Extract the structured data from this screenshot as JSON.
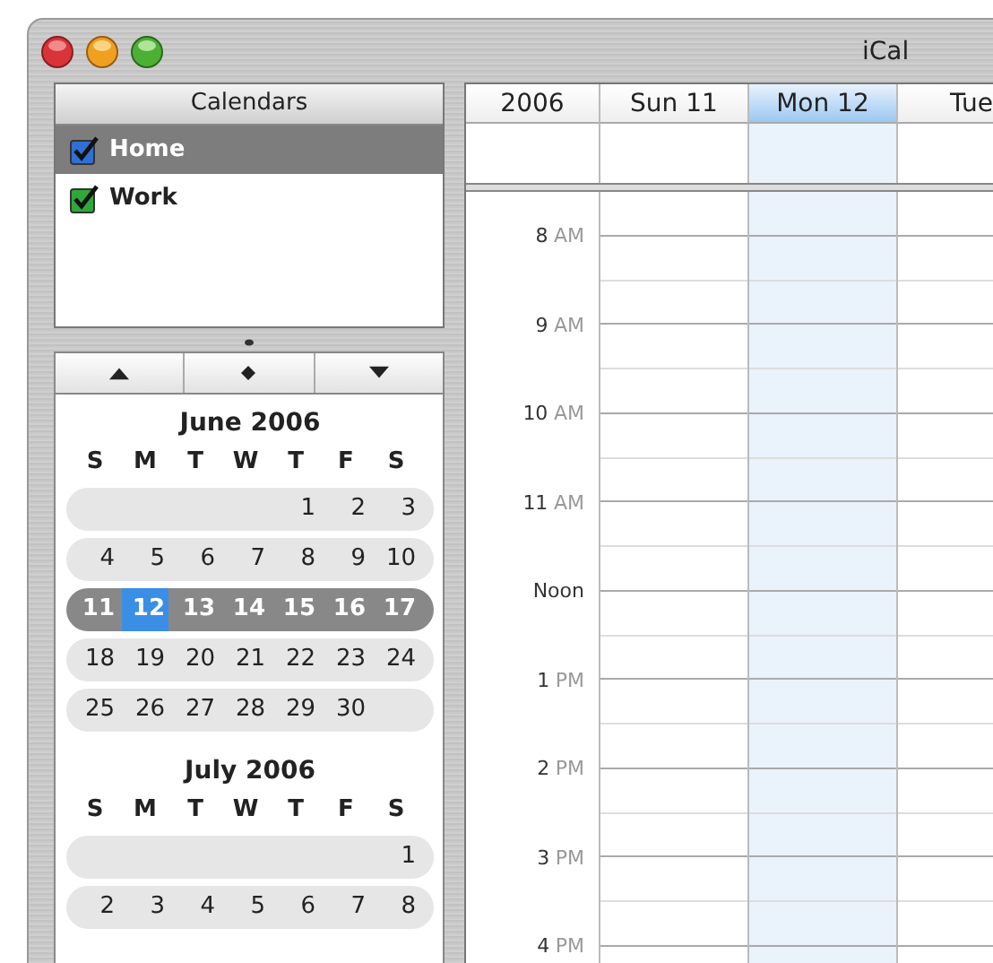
{
  "window": {
    "title": "iCal"
  },
  "calendars": {
    "header": "Calendars",
    "items": [
      {
        "name": "Home",
        "checked": true,
        "selected": true,
        "color": "#2f6fd6"
      },
      {
        "name": "Work",
        "checked": true,
        "selected": false,
        "color": "#2fa83a"
      }
    ]
  },
  "mini_calendars": [
    {
      "title": "June 2006",
      "weekdays": [
        "S",
        "M",
        "T",
        "W",
        "T",
        "F",
        "S"
      ],
      "weeks": [
        {
          "selected": false,
          "days": [
            {
              "label": "1",
              "selected": false
            },
            {
              "label": "2",
              "selected": false
            },
            {
              "label": "3",
              "selected": false
            }
          ]
        },
        {
          "selected": false,
          "days": [
            {
              "label": "4",
              "selected": false
            },
            {
              "label": "5",
              "selected": false
            },
            {
              "label": "6",
              "selected": false
            },
            {
              "label": "7",
              "selected": false
            },
            {
              "label": "8",
              "selected": false
            },
            {
              "label": "9",
              "selected": false
            },
            {
              "label": "10",
              "selected": false
            }
          ]
        },
        {
          "selected": true,
          "days": [
            {
              "label": "11",
              "selected": false
            },
            {
              "label": "12",
              "selected": true
            },
            {
              "label": "13",
              "selected": false
            },
            {
              "label": "14",
              "selected": false
            },
            {
              "label": "15",
              "selected": false
            },
            {
              "label": "16",
              "selected": false
            },
            {
              "label": "17",
              "selected": false
            }
          ]
        },
        {
          "selected": false,
          "days": [
            {
              "label": "18",
              "selected": false
            },
            {
              "label": "19",
              "selected": false
            },
            {
              "label": "20",
              "selected": false
            },
            {
              "label": "21",
              "selected": false
            },
            {
              "label": "22",
              "selected": false
            },
            {
              "label": "23",
              "selected": false
            },
            {
              "label": "24",
              "selected": false
            }
          ]
        },
        {
          "selected": false,
          "days": [
            {
              "label": "25",
              "selected": false
            },
            {
              "label": "26",
              "selected": false
            },
            {
              "label": "27",
              "selected": false
            },
            {
              "label": "28",
              "selected": false
            },
            {
              "label": "29",
              "selected": false
            },
            {
              "label": "30",
              "selected": false
            }
          ]
        }
      ]
    },
    {
      "title": "July 2006",
      "weekdays": [
        "S",
        "M",
        "T",
        "W",
        "T",
        "F",
        "S"
      ],
      "weeks": [
        {
          "selected": false,
          "days": [
            {
              "label": "1",
              "selected": false
            }
          ]
        },
        {
          "selected": false,
          "days": [
            {
              "label": "2",
              "selected": false
            },
            {
              "label": "3",
              "selected": false
            },
            {
              "label": "4",
              "selected": false
            },
            {
              "label": "5",
              "selected": false
            },
            {
              "label": "6",
              "selected": false
            },
            {
              "label": "7",
              "selected": false
            },
            {
              "label": "8",
              "selected": false
            }
          ]
        }
      ]
    }
  ],
  "week_view": {
    "year": "2006",
    "days": [
      {
        "label": "Sun 11",
        "selected": false
      },
      {
        "label": "Mon 12",
        "selected": true
      },
      {
        "label": "Tue",
        "selected": false
      }
    ],
    "hours": [
      {
        "hour": "8",
        "period": "AM"
      },
      {
        "hour": "9",
        "period": "AM"
      },
      {
        "hour": "10",
        "period": "AM"
      },
      {
        "hour": "11",
        "period": "AM"
      },
      {
        "hour": "Noon"
      },
      {
        "hour": "1",
        "period": "PM"
      },
      {
        "hour": "2",
        "period": "PM"
      },
      {
        "hour": "3",
        "period": "PM"
      },
      {
        "hour": "4",
        "period": "PM"
      }
    ]
  }
}
